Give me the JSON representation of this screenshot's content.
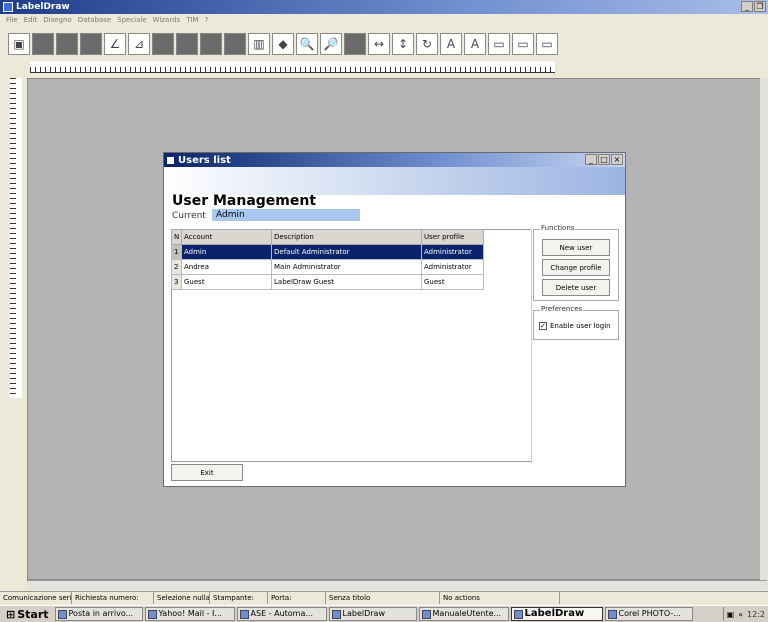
{
  "app": {
    "title": "LabelDraw"
  },
  "menu": [
    "File",
    "Edit",
    "Disegno",
    "Database",
    "Speciale",
    "Wizards",
    "TIM",
    "?"
  ],
  "dialog": {
    "title": "Users list",
    "heading": "User Management",
    "current_label": "Current",
    "current_value": "Admin",
    "grid": {
      "columns": [
        "N",
        "Account",
        "Description",
        "User profile"
      ],
      "rows": [
        {
          "n": "1",
          "account": "Admin",
          "description": "Default Administrator",
          "profile": "Administrator"
        },
        {
          "n": "2",
          "account": "Andrea",
          "description": "Main Administrator",
          "profile": "Administrator"
        },
        {
          "n": "3",
          "account": "Guest",
          "description": "LabelDraw Guest",
          "profile": "Guest"
        }
      ]
    },
    "functions": {
      "title": "Functions",
      "new_user": "New user",
      "change_profile": "Change profile",
      "delete_user": "Delete user"
    },
    "preferences": {
      "title": "Preferences",
      "enable_login": "Enable user login",
      "enable_login_checked": true
    },
    "exit_label": "Exit"
  },
  "status": [
    "Comunicazione seriale OF",
    "Richiesta numero:",
    "Selezione nulla",
    "Stampante:",
    "Porta:",
    "Senza titolo",
    "No actions"
  ],
  "taskbar": {
    "start": "Start",
    "tasks": [
      "Posta in arrivo...",
      "Yahoo! Mail - I...",
      "ASE - Automa...",
      "LabelDraw",
      "ManualeUtente...",
      "LabelDraw",
      "Corel PHOTO-..."
    ],
    "active_index": 5,
    "clock": "12:2"
  },
  "colors": {
    "selection": "#0a246a",
    "current_bg": "#a9c8f0",
    "canvas": "#b3b3b3"
  }
}
